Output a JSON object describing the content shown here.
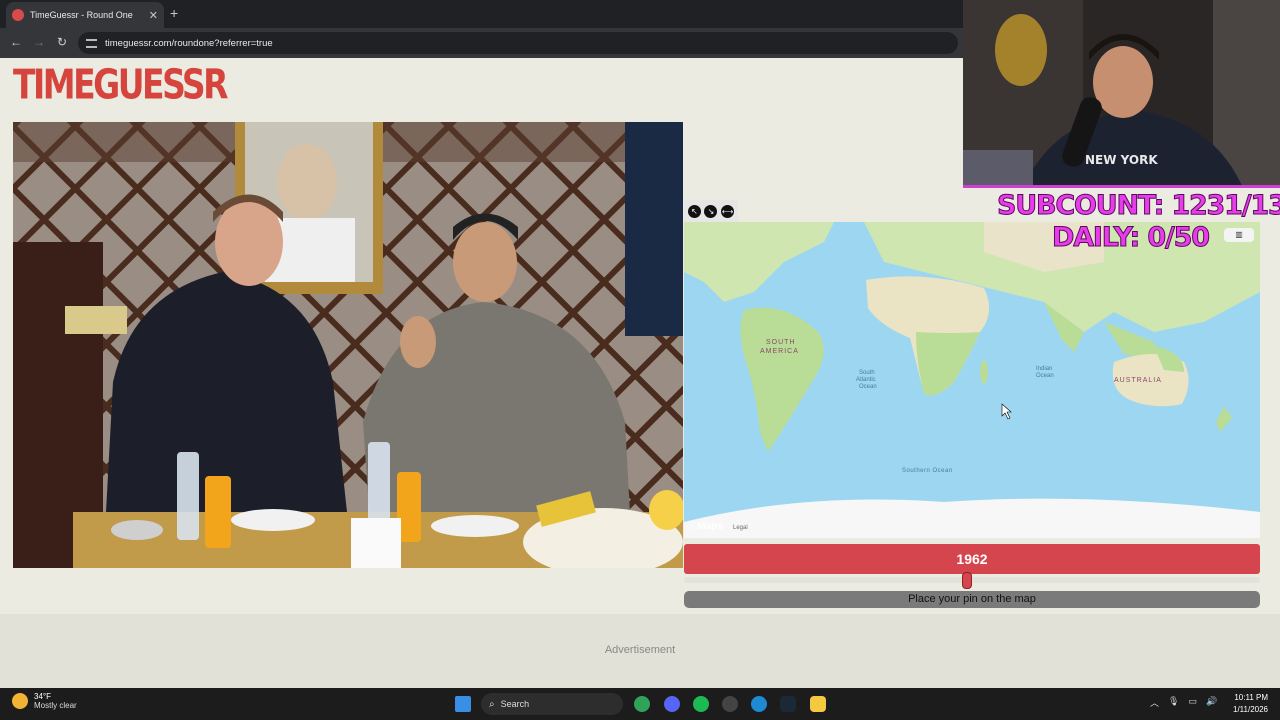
{
  "browser": {
    "tab_title": "TimeGuessr - Round One",
    "tab_close": "✕",
    "new_tab": "+",
    "back": "←",
    "forward": "→",
    "reload": "↻",
    "url": "timeguessr.com/roundone?referrer=true"
  },
  "page": {
    "logo": "TIMEGUESSR",
    "map_tools": [
      "↖",
      "↘",
      "⟷"
    ],
    "map": {
      "labels": {
        "south_america": "SOUTH AMERICA",
        "south_atlantic": "South Atlantic Ocean",
        "indian_ocean": "Indian Ocean",
        "australia": "AUSTRALIA",
        "southern_ocean": "Southern Ocean"
      },
      "logo": "Maps",
      "legal": "Legal"
    },
    "year": "1962",
    "year_slider_fraction": 0.5,
    "pin_prompt": "Place your pin on the map",
    "ad_label": "Advertisement"
  },
  "overlay": {
    "subcount": "SUBCOUNT: 1231/1300",
    "daily": "DAILY: 0/50"
  },
  "taskbar": {
    "temp": "34°F",
    "condition": "Mostly clear",
    "search_label": "Search",
    "time": "10:11 PM",
    "date": "1/11/2026"
  },
  "colors": {
    "accent": "#d5454d",
    "overlay_text": "#e63de8"
  }
}
